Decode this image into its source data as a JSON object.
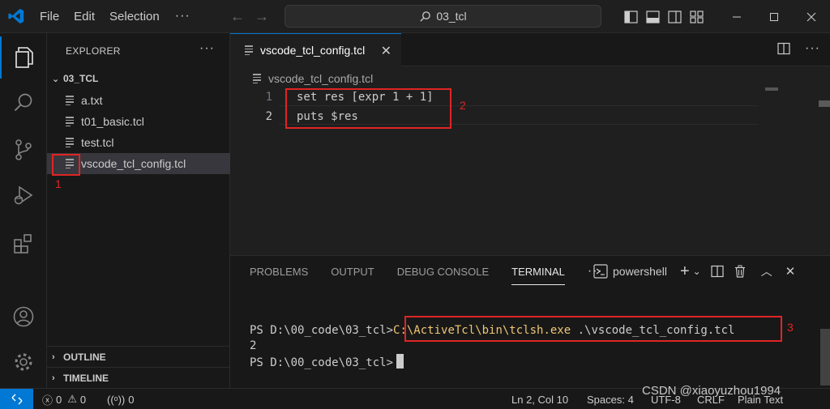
{
  "titlebar": {
    "menu": [
      "File",
      "Edit",
      "Selection"
    ],
    "more": "···",
    "command_center": "03_tcl"
  },
  "sidebar": {
    "header": "EXPLORER",
    "more": "···",
    "folder": "03_TCL",
    "files": [
      "a.txt",
      "t01_basic.tcl",
      "test.tcl",
      "vscode_tcl_config.tcl"
    ],
    "selected_index": 3,
    "sections": [
      "OUTLINE",
      "TIMELINE"
    ]
  },
  "editor": {
    "tab_label": "vscode_tcl_config.tcl",
    "breadcrumb": "vscode_tcl_config.tcl",
    "lines": [
      {
        "num": "1",
        "code": "set res [expr 1 + 1]"
      },
      {
        "num": "2",
        "code": "puts $res"
      }
    ]
  },
  "panel": {
    "tabs": [
      "PROBLEMS",
      "OUTPUT",
      "DEBUG CONSOLE",
      "TERMINAL"
    ],
    "active_tab": "TERMINAL",
    "more": "···",
    "shell": "powershell",
    "terminal": {
      "prompt": "PS D:\\00_code\\03_tcl>",
      "exe": "C:\\ActiveTcl\\bin\\tclsh.exe",
      "arg": " .\\vscode_tcl_config.tcl",
      "output": "2",
      "prompt2": "PS D:\\00_code\\03_tcl>"
    }
  },
  "statusbar": {
    "errors": "0",
    "warnings": "0",
    "ports": "0",
    "position": "Ln 2, Col 10",
    "spaces": "Spaces: 4",
    "encoding": "UTF-8",
    "eol": "CRLF",
    "language": "Plain Text"
  },
  "annotations": [
    "1",
    "2",
    "3"
  ],
  "watermark": "CSDN @xiaoyuzhou1994",
  "colors": {
    "accent": "#0078d4",
    "annotation": "#e02424"
  }
}
